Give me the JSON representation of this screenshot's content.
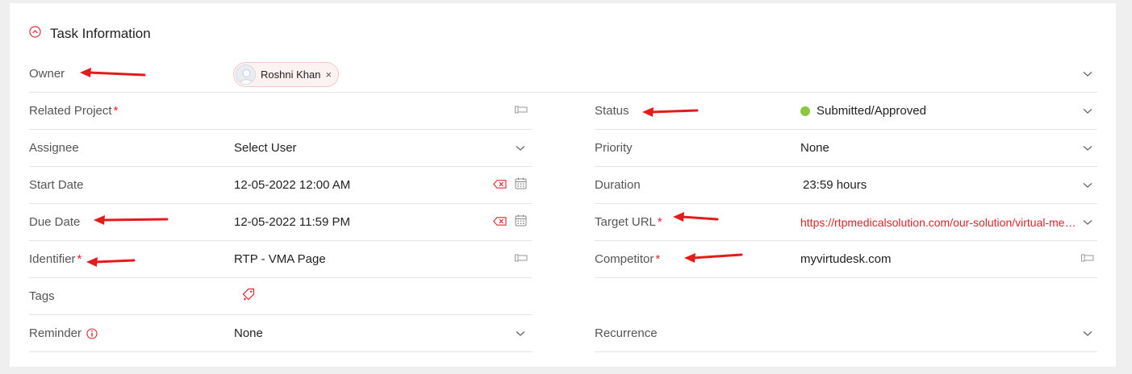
{
  "section": {
    "title": "Task Information",
    "collapse_icon": "chevron-up-circle-icon"
  },
  "owner": {
    "label": "Owner",
    "value": "Roshni Khan",
    "remove": "×"
  },
  "left": {
    "related_project": {
      "label": "Related Project",
      "required": "*"
    },
    "assignee": {
      "label": "Assignee",
      "value": "Select User"
    },
    "start_date": {
      "label": "Start Date",
      "value": "12-05-2022 12:00 AM"
    },
    "due_date": {
      "label": "Due Date",
      "value": "12-05-2022 11:59 PM"
    },
    "identifier": {
      "label": "Identifier",
      "required": "*",
      "value": "RTP - VMA Page"
    },
    "tags": {
      "label": "Tags"
    },
    "reminder": {
      "label": "Reminder",
      "value": "None"
    }
  },
  "right": {
    "status": {
      "label": "Status",
      "value": "Submitted/Approved",
      "dot_color": "#8dc63f"
    },
    "priority": {
      "label": "Priority",
      "value": "None"
    },
    "duration": {
      "label": "Duration",
      "value": "23:59 hours"
    },
    "target_url": {
      "label": "Target URL",
      "required": "*",
      "value": "https://rtpmedicalsolution.com/our-solution/virtual-medical-assistant/"
    },
    "competitor": {
      "label": "Competitor",
      "required": "*",
      "value": "myvirtudesk.com"
    },
    "recurrence": {
      "label": "Recurrence"
    }
  },
  "colors": {
    "accent": "#e0242c",
    "annotation_arrow": "#e31b1b",
    "status_green": "#8dc63f"
  }
}
